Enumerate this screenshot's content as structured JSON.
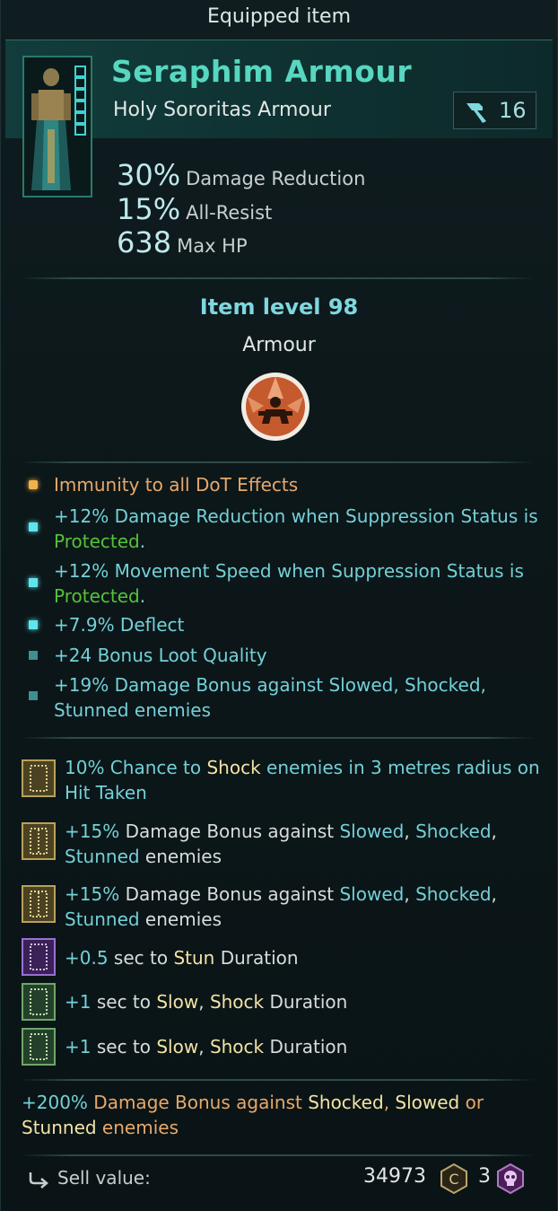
{
  "header": {
    "title": "Equipped item"
  },
  "item": {
    "name": "Seraphim Armour",
    "subtitle": "Holy Sororitas Armour",
    "power_level": "16",
    "icon": "hammer-icon"
  },
  "stats": [
    {
      "value": "30%",
      "label": "Damage Reduction"
    },
    {
      "value": "15%",
      "label": "All-Resist"
    },
    {
      "value": "638",
      "label": "Max HP"
    }
  ],
  "item_level": "Item level 98",
  "item_type": "Armour",
  "traits": {
    "t1": "Immunity to all DoT Effects",
    "t2a": "+12% Damage Reduction when Suppression Status is ",
    "t2b": "Protected",
    "t2c": ".",
    "t3a": "+12% Movement Speed when Suppression Status is ",
    "t3b": "Protected",
    "t3c": ".",
    "t4": "+7.9% Deflect",
    "t5": "+24 Bonus Loot Quality",
    "t6a": "+19% Damage Bonus against ",
    "t6b": "Slowed",
    "t6c": ", ",
    "t6d": "Shocked",
    "t6e": ",",
    "t6f": "Stunned",
    "t6g": " enemies"
  },
  "runes": {
    "r1a": "10%",
    "r1b": " Chance to ",
    "r1c": "Shock",
    "r1d": " enemies in 3 metres radius on Hit Taken",
    "r2a": "+15%",
    "r2b": " Damage Bonus against ",
    "r2c": "Slowed",
    "r2d": ", ",
    "r2e": "Shocked",
    "r2f": ",",
    "r2g": "Stunned",
    "r2h": " enemies",
    "r3a": "+15%",
    "r3b": " Damage Bonus against ",
    "r3c": "Slowed",
    "r3d": ", ",
    "r3e": "Shocked",
    "r3f": ",",
    "r3g": "Stunned",
    "r3h": " enemies",
    "r4a": "+0.5",
    "r4b": " sec to ",
    "r4c": "Stun",
    "r4d": " Duration",
    "r5a": "+1",
    "r5b": " sec to ",
    "r5c": "Slow",
    "r5d": ", ",
    "r5e": "Shock",
    "r5f": " Duration",
    "r6a": "+1",
    "r6b": " sec to ",
    "r6c": "Slow",
    "r6d": ", ",
    "r6e": "Shock",
    "r6f": " Duration"
  },
  "set_bonus": {
    "a": "+200%",
    "b": " Damage Bonus against ",
    "c": "Shocked",
    "d": ", ",
    "e": "Slowed",
    "f": " or ",
    "g": "Stunned",
    "h": " enemies"
  },
  "sell": {
    "label": "Sell value:",
    "credits": "34973",
    "skulls": "3"
  },
  "colors": {
    "accent": "#57d6c0",
    "positive": "#55c23a",
    "legendary": "#e8a86a",
    "keyword": "#f3e3a5"
  }
}
